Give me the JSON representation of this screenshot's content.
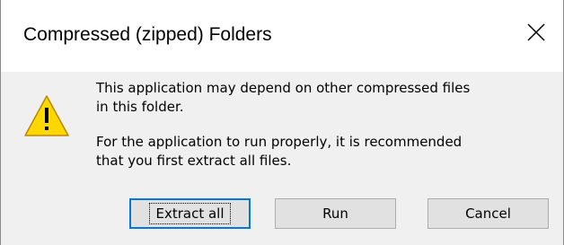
{
  "window": {
    "title": "Compressed (zipped) Folders",
    "close_icon": "close-icon"
  },
  "content": {
    "icon": "warning-icon",
    "message_line1": "This application may depend on other compressed files",
    "message_line2": "in this folder.",
    "message_line3": "For the application to run properly, it is recommended",
    "message_line4": "that you first extract all files."
  },
  "buttons": {
    "extract_all": "Extract all",
    "run": "Run",
    "cancel": "Cancel"
  },
  "colors": {
    "dialog_body": "#f0f0f0",
    "title_bar": "#ffffff",
    "warning_fill": "#ffd700",
    "default_button_border": "#0078d7"
  }
}
